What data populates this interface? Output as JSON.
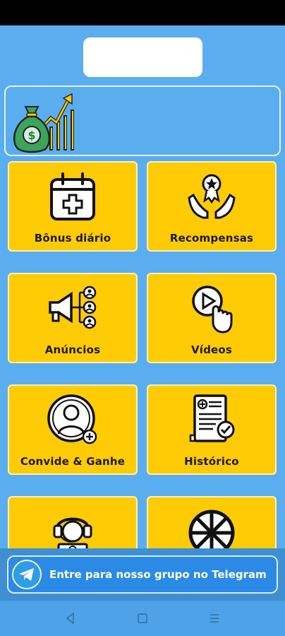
{
  "tiles": {
    "daily_bonus": {
      "label": "Bônus diário",
      "icon": "calendar-plus-icon"
    },
    "rewards": {
      "label": "Recompensas",
      "icon": "award-hands-icon"
    },
    "ads": {
      "label": "Anúncios",
      "icon": "megaphone-icon"
    },
    "videos": {
      "label": "Vídeos",
      "icon": "video-tap-icon"
    },
    "invite": {
      "label": "Convide & Ganhe",
      "icon": "user-add-icon"
    },
    "history": {
      "label": "Histórico",
      "icon": "document-check-icon"
    },
    "support": {
      "label": "",
      "icon": "support-agent-icon"
    },
    "wheel": {
      "label": "",
      "icon": "prize-wheel-icon"
    }
  },
  "banner": {
    "icon": "money-growth-icon"
  },
  "telegram": {
    "label": "Entre para nosso grupo no Telegram",
    "icon": "telegram-icon"
  },
  "nav": {
    "back": "back-icon",
    "home": "home-icon",
    "recents": "recents-icon"
  },
  "colors": {
    "background": "#5aaef0",
    "tile": "#ffcb05",
    "telegram_button": "#2a8ae6"
  }
}
